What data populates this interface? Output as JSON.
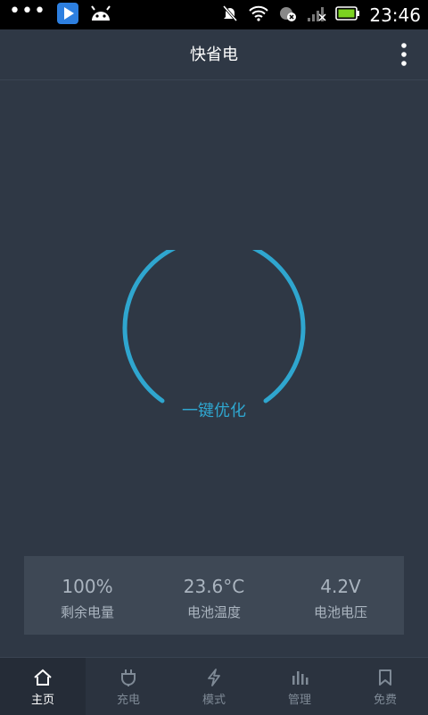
{
  "status_bar": {
    "dots": "•••",
    "time": "23:46"
  },
  "header": {
    "title": "快省电"
  },
  "main": {
    "optimize_label": "一键优化"
  },
  "stats": [
    {
      "value": "100%",
      "label": "剩余电量"
    },
    {
      "value": "23.6°C",
      "label": "电池温度"
    },
    {
      "value": "4.2V",
      "label": "电池电压"
    }
  ],
  "nav": [
    {
      "label": "主页",
      "icon": "home-icon"
    },
    {
      "label": "充电",
      "icon": "plug-icon"
    },
    {
      "label": "模式",
      "icon": "bolt-icon"
    },
    {
      "label": "管理",
      "icon": "bar-chart-icon"
    },
    {
      "label": "免费",
      "icon": "bookmark-icon"
    }
  ],
  "colors": {
    "background": "#2f3845",
    "accent": "#2fa6cf",
    "panel": "#3e4855",
    "battery": "#7cd321"
  }
}
